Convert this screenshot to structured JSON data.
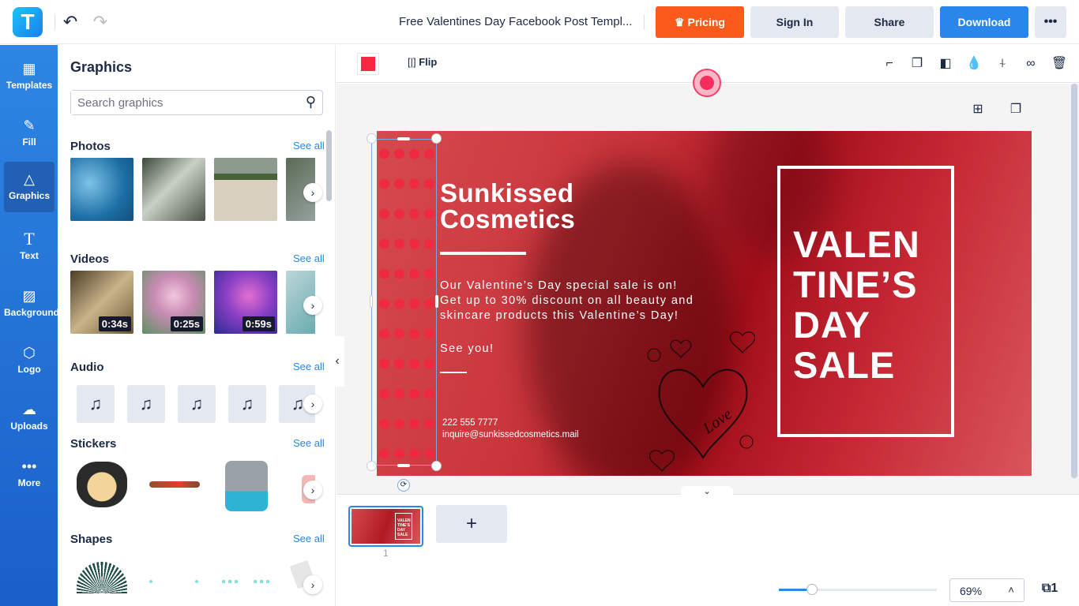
{
  "app": {
    "logo_letter": "T"
  },
  "header": {
    "doc_title": "Free Valentines Day Facebook Post Templ...",
    "buttons": {
      "pricing": "Pricing",
      "sign_in": "Sign In",
      "share": "Share",
      "download": "Download",
      "more": "•••"
    },
    "icons": {
      "undo": "↶",
      "redo": "↷",
      "crown": "♛"
    }
  },
  "leftnav": {
    "items": [
      {
        "label": "Templates",
        "icon": "▦"
      },
      {
        "label": "Fill",
        "icon": "✎"
      },
      {
        "label": "Graphics",
        "icon": "△",
        "active": true
      },
      {
        "label": "Text",
        "icon": "T"
      },
      {
        "label": "Background",
        "icon": "▨"
      },
      {
        "label": "Logo",
        "icon": "⬡"
      },
      {
        "label": "Uploads",
        "icon": "☁"
      },
      {
        "label": "More",
        "icon": "•••"
      }
    ]
  },
  "panel": {
    "title": "Graphics",
    "search": {
      "placeholder": "Search graphics",
      "value": "",
      "icon": "⚲"
    },
    "sections": {
      "photos": {
        "title": "Photos",
        "see_all": "See all"
      },
      "videos": {
        "title": "Videos",
        "see_all": "See all",
        "durations": [
          "0:34s",
          "0:25s",
          "0:59s"
        ]
      },
      "audio": {
        "title": "Audio",
        "see_all": "See all",
        "icon": "♫"
      },
      "stickers": {
        "title": "Stickers",
        "see_all": "See all"
      },
      "shapes": {
        "title": "Shapes",
        "see_all": "See all"
      }
    },
    "next_arrow": "›"
  },
  "toolbar": {
    "selected_color": "#f42840",
    "flip_label": "Flip",
    "flip_icon": "[|]",
    "icons": {
      "paint_roller": "⌐",
      "copy_style": "❐",
      "arrange": "◧",
      "opacity": "💧",
      "align": "⍭",
      "link": "∞",
      "delete": "🗑"
    }
  },
  "workspace": {
    "add_page_icon": "⊞",
    "duplicate_icon": "❐",
    "collapse_left": "‹",
    "collapse_down": "⌄"
  },
  "design": {
    "brand_line1": "Sunkissed",
    "brand_line2": "Cosmetics",
    "body": "Our Valentine’s Day special sale is on!\nGet up to 30% discount on all beauty and\nskincare products this Valentine’s Day!",
    "see_you": "See you!",
    "phone": "222 555 7777",
    "email": "inquire@sunkissedcosmetics.mail",
    "headline": [
      "VALEN",
      "TINE’S",
      "DAY",
      "SALE"
    ],
    "love_text": "Love"
  },
  "pages": {
    "current_page": "1",
    "add_icon": "+",
    "thumb_text": "VALEN TINE'S DAY SALE"
  },
  "zoom": {
    "level_label": "69%",
    "level_percent": 69,
    "slider_fraction": 0.21,
    "caret": "˄",
    "pages_icon": "⧉1"
  }
}
